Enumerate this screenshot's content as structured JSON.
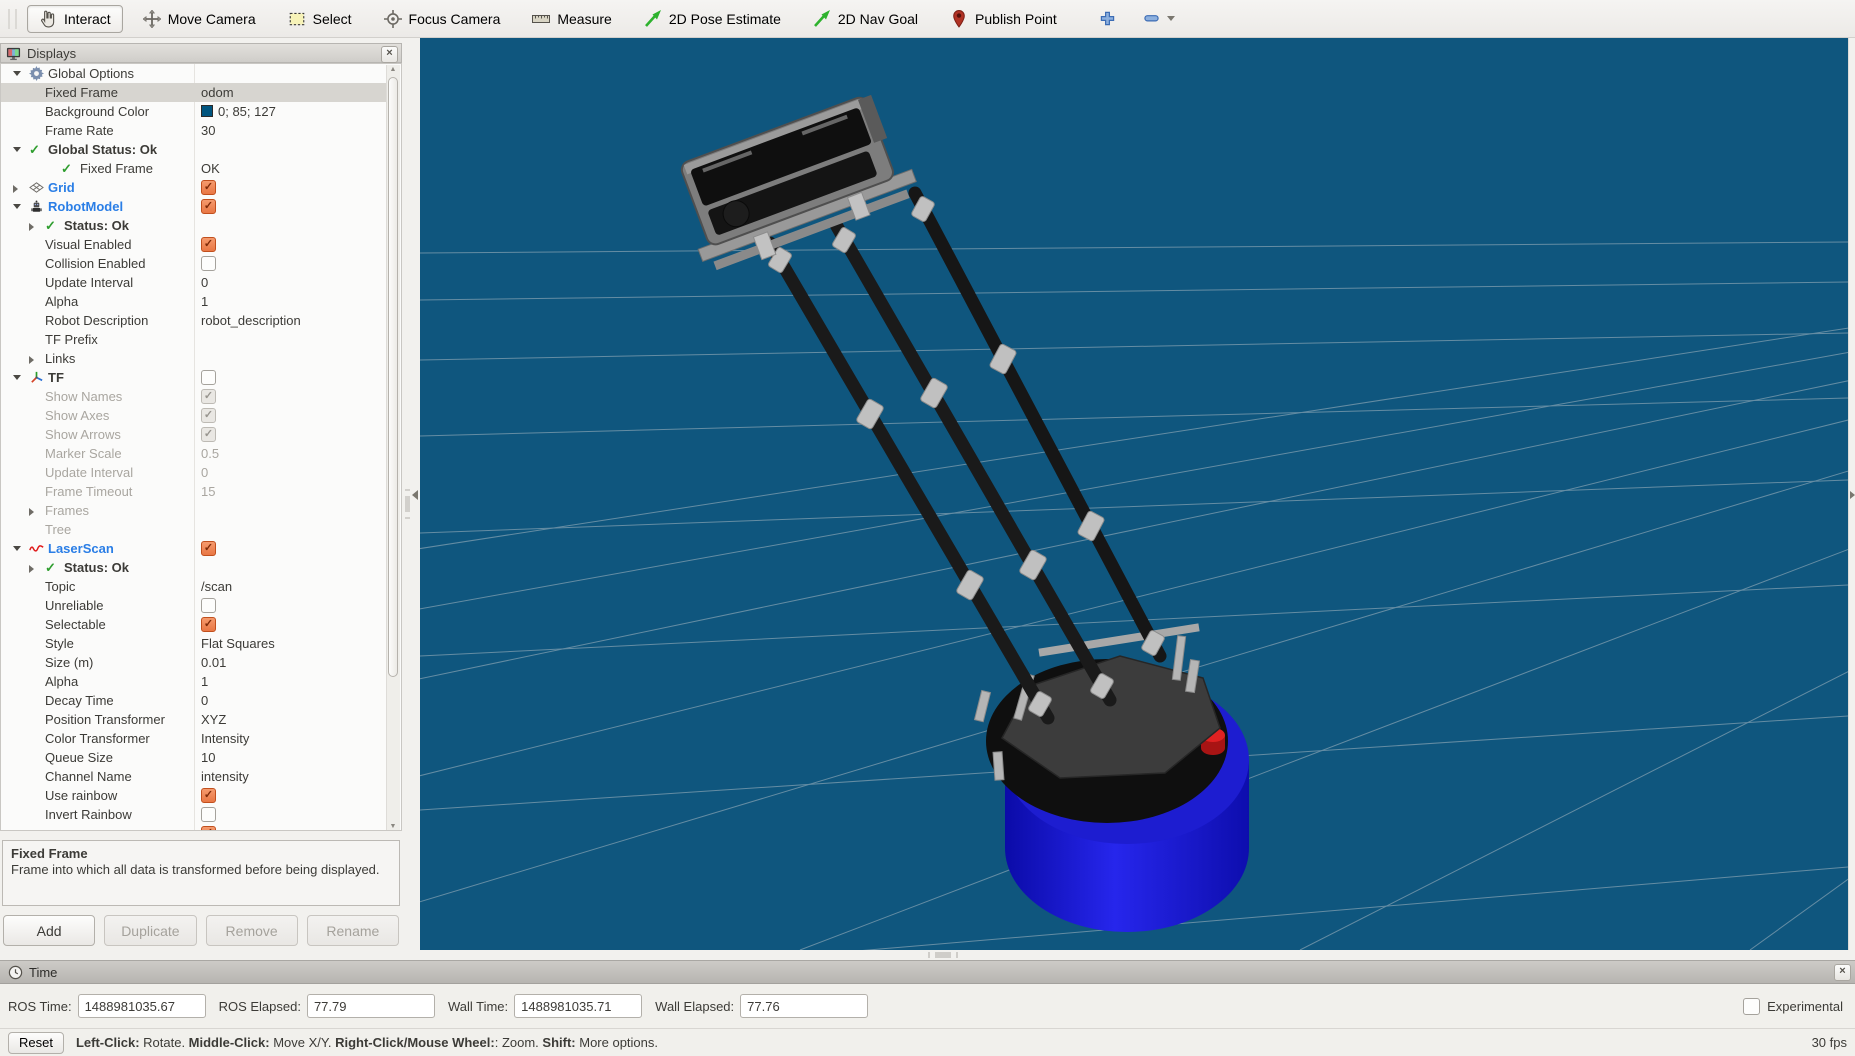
{
  "toolbar": {
    "tools": [
      {
        "label": "Interact",
        "icon": "hand",
        "active": true
      },
      {
        "label": "Move Camera",
        "icon": "move",
        "active": false
      },
      {
        "label": "Select",
        "icon": "select",
        "active": false
      },
      {
        "label": "Focus Camera",
        "icon": "focus",
        "active": false
      },
      {
        "label": "Measure",
        "icon": "measure",
        "active": false
      },
      {
        "label": "2D Pose Estimate",
        "icon": "greenarrow",
        "active": false
      },
      {
        "label": "2D Nav Goal",
        "icon": "greenarrow",
        "active": false
      },
      {
        "label": "Publish Point",
        "icon": "pin",
        "active": false
      }
    ]
  },
  "displays_panel": {
    "title": "Displays",
    "rows": [
      {
        "label": "Global Options",
        "icon": "gear",
        "expander": "open",
        "depth": 0
      },
      {
        "label": "Fixed Frame",
        "value": "odom",
        "depth": 1,
        "selected": true
      },
      {
        "label": "Background Color",
        "value": "0; 85; 127",
        "swatch": "#00557F",
        "depth": 1
      },
      {
        "label": "Frame Rate",
        "value": "30",
        "depth": 1
      },
      {
        "label": "Global Status: Ok",
        "icon": "check",
        "expander": "open",
        "depth": 0,
        "bold": true
      },
      {
        "label": "Fixed Frame",
        "value": "OK",
        "icon": "check",
        "depth": 2
      },
      {
        "label": "Grid",
        "icon": "grid",
        "expander": "closed",
        "depth": 0,
        "blue": true,
        "check": "checked"
      },
      {
        "label": "RobotModel",
        "icon": "robot",
        "expander": "open",
        "depth": 0,
        "blue": true,
        "check": "checked"
      },
      {
        "label": "Status: Ok",
        "icon": "check",
        "expander": "closed",
        "depth": 1,
        "bold": true
      },
      {
        "label": "Visual Enabled",
        "check": "checked",
        "depth": 1
      },
      {
        "label": "Collision Enabled",
        "check": "unchecked",
        "depth": 1
      },
      {
        "label": "Update Interval",
        "value": "0",
        "depth": 1
      },
      {
        "label": "Alpha",
        "value": "1",
        "depth": 1
      },
      {
        "label": "Robot Description",
        "value": "robot_description",
        "depth": 1
      },
      {
        "label": "TF Prefix",
        "value": "",
        "depth": 1
      },
      {
        "label": "Links",
        "expander": "closed",
        "depth": 1
      },
      {
        "label": "TF",
        "icon": "tf",
        "expander": "open",
        "depth": 0,
        "bold": true,
        "check": "unchecked"
      },
      {
        "label": "Show Names",
        "check": "checked-disabled",
        "depth": 1,
        "grayed": true
      },
      {
        "label": "Show Axes",
        "check": "checked-disabled",
        "depth": 1,
        "grayed": true
      },
      {
        "label": "Show Arrows",
        "check": "checked-disabled",
        "depth": 1,
        "grayed": true
      },
      {
        "label": "Marker Scale",
        "value": "0.5",
        "depth": 1,
        "grayed": true
      },
      {
        "label": "Update Interval",
        "value": "0",
        "depth": 1,
        "grayed": true
      },
      {
        "label": "Frame Timeout",
        "value": "15",
        "depth": 1,
        "grayed": true
      },
      {
        "label": "Frames",
        "expander": "closed",
        "depth": 1,
        "grayed": true
      },
      {
        "label": "Tree",
        "depth": 1,
        "grayed": true
      },
      {
        "label": "LaserScan",
        "icon": "laser",
        "expander": "open",
        "depth": 0,
        "blue": true,
        "check": "checked"
      },
      {
        "label": "Status: Ok",
        "icon": "check",
        "expander": "closed",
        "depth": 1,
        "bold": true
      },
      {
        "label": "Topic",
        "value": "/scan",
        "depth": 1
      },
      {
        "label": "Unreliable",
        "check": "unchecked",
        "depth": 1
      },
      {
        "label": "Selectable",
        "check": "checked",
        "depth": 1
      },
      {
        "label": "Style",
        "value": "Flat Squares",
        "depth": 1
      },
      {
        "label": "Size (m)",
        "value": "0.01",
        "depth": 1
      },
      {
        "label": "Alpha",
        "value": "1",
        "depth": 1
      },
      {
        "label": "Decay Time",
        "value": "0",
        "depth": 1
      },
      {
        "label": "Position Transformer",
        "value": "XYZ",
        "depth": 1
      },
      {
        "label": "Color Transformer",
        "value": "Intensity",
        "depth": 1
      },
      {
        "label": "Queue Size",
        "value": "10",
        "depth": 1
      },
      {
        "label": "Channel Name",
        "value": "intensity",
        "depth": 1
      },
      {
        "label": "Use rainbow",
        "check": "checked",
        "depth": 1
      },
      {
        "label": "Invert Rainbow",
        "check": "unchecked",
        "depth": 1
      },
      {
        "label": "",
        "check": "checked",
        "depth": 1,
        "partial": true
      }
    ],
    "description_title": "Fixed Frame",
    "description_body": "Frame into which all data is transformed before being displayed.",
    "buttons": [
      {
        "label": "Add",
        "enabled": true
      },
      {
        "label": "Duplicate",
        "enabled": false
      },
      {
        "label": "Remove",
        "enabled": false
      },
      {
        "label": "Rename",
        "enabled": false
      }
    ]
  },
  "time_panel": {
    "title": "Time",
    "fields": [
      {
        "label": "ROS Time:",
        "value": "1488981035.67"
      },
      {
        "label": "ROS Elapsed:",
        "value": "77.79"
      },
      {
        "label": "Wall Time:",
        "value": "1488981035.71"
      },
      {
        "label": "Wall Elapsed:",
        "value": "77.76"
      }
    ],
    "experimental_label": "Experimental"
  },
  "status_bar": {
    "reset_label": "Reset",
    "segments": [
      {
        "text": "Left-Click:",
        "bold": true
      },
      {
        "text": " Rotate. ",
        "bold": false
      },
      {
        "text": "Middle-Click:",
        "bold": true
      },
      {
        "text": " Move X/Y. ",
        "bold": false
      },
      {
        "text": "Right-Click/Mouse Wheel:",
        "bold": true
      },
      {
        "text": ": Zoom. ",
        "bold": false
      },
      {
        "text": "Shift:",
        "bold": true
      },
      {
        "text": " More options.",
        "bold": false
      }
    ],
    "fps": "30 fps"
  },
  "viewport": {
    "background_color": "#0F567E"
  },
  "colors": {
    "background_3d": "#0F567E",
    "enabled_display_blue": "#2A7EE6",
    "checkbox_orange": "#E97744",
    "robot_base_blue": "#1B1BD8",
    "selection_gray": "#D7D5D0"
  }
}
